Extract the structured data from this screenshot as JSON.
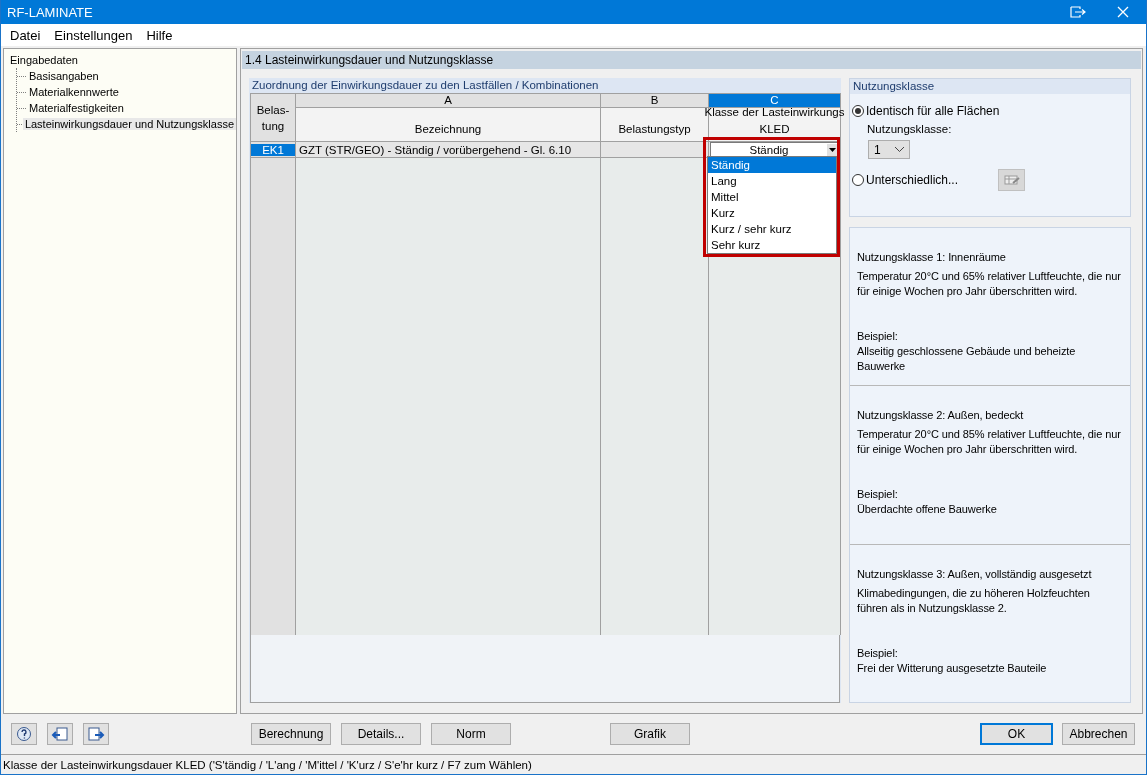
{
  "window": {
    "title": "RF-LAMINATE"
  },
  "menu": [
    "Datei",
    "Einstellungen",
    "Hilfe"
  ],
  "tree": {
    "label": "Eingabedaten",
    "children": [
      {
        "label": "Basisangaben",
        "selected": false
      },
      {
        "label": "Materialkennwerte",
        "selected": false
      },
      {
        "label": "Materialfestigkeiten",
        "selected": false
      },
      {
        "label": "Lasteinwirkungsdauer und Nutzungsklasse",
        "selected": true
      }
    ]
  },
  "page_title": "1.4 Lasteinwirkungsdauer und Nutzungsklasse",
  "table": {
    "title": "Zuordnung der Einwirkungsdauer zu den Lastfällen / Kombinationen",
    "row_header": "Belas-\ntung",
    "columns": [
      {
        "letter": "A",
        "header": "Bezeichnung",
        "selected": false
      },
      {
        "letter": "B",
        "header": "Belastungstyp",
        "selected": false
      },
      {
        "letter": "C",
        "header": "Klasse der Lasteinwirkungs\nKLED",
        "selected": true
      }
    ],
    "rows": [
      {
        "id": "EK1",
        "selected": true,
        "bezeichnung": "GZT (STR/GEO) - Ständig / vorübergehend - Gl. 6.10",
        "kled": "Ständig"
      }
    ],
    "dropdown": [
      {
        "label": "Ständig",
        "selected": true
      },
      {
        "label": "Lang",
        "selected": false
      },
      {
        "label": "Mittel",
        "selected": false
      },
      {
        "label": "Kurz",
        "selected": false
      },
      {
        "label": "Kurz / sehr kurz",
        "selected": false
      },
      {
        "label": "Sehr kurz",
        "selected": false
      }
    ]
  },
  "nutzungsklasse": {
    "title": "Nutzungsklasse",
    "radios": [
      {
        "label": "Identisch für alle Flächen",
        "selected": true
      },
      {
        "label": "Unterschiedlich...",
        "selected": false
      }
    ],
    "field_label": "Nutzungsklasse:",
    "value": "1"
  },
  "info": [
    {
      "heading": "Nutzungsklasse 1: Innenräume",
      "text": "Temperatur 20°C und 65% relativer Luftfeuchte, die nur für einige Wochen pro Jahr überschritten wird.",
      "example_label": "Beispiel:",
      "example": "Allseitig geschlossene Gebäude und beheizte Bauwerke"
    },
    {
      "heading": "Nutzungsklasse 2: Außen, bedeckt",
      "text": "Temperatur 20°C und 85% relativer Luftfeuchte, die nur für einige Wochen pro Jahr überschritten wird.",
      "example_label": "Beispiel:",
      "example": "Überdachte offene Bauwerke"
    },
    {
      "heading": "Nutzungsklasse 3: Außen, vollständig ausgesetzt",
      "text": "Klimabedingungen, die zu höheren Holzfeuchten führen als in Nutzungsklasse 2.",
      "example_label": "Beispiel:",
      "example": "Frei der Witterung ausgesetzte Bauteile"
    }
  ],
  "buttons": {
    "middle": [
      "Berechnung",
      "Details...",
      "Norm"
    ],
    "grafik": "Grafik",
    "ok": "OK",
    "cancel": "Abbrechen"
  },
  "status_bar": "Klasse der Lasteinwirkungsdauer KLED ('S'tändig / 'L'ang / 'M'ittel / 'K'urz / S'e'hr kurz / F7 zum Wählen)"
}
